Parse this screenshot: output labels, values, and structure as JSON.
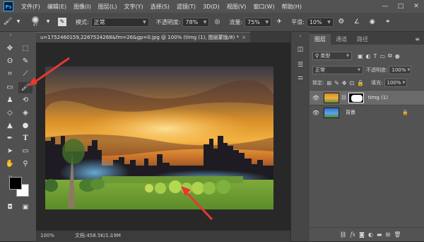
{
  "app": {
    "logo": "Ps"
  },
  "menu": [
    "文件(F)",
    "编辑(E)",
    "图像(I)",
    "图层(L)",
    "文字(Y)",
    "选择(S)",
    "滤镜(T)",
    "3D(D)",
    "视图(V)",
    "窗口(W)",
    "帮助(H)"
  ],
  "window_controls": {
    "minimize": "—",
    "maximize": "□",
    "close": "✕"
  },
  "options": {
    "brush_size": "47",
    "mode_label": "模式:",
    "mode_value": "正常",
    "opacity_label": "不透明度:",
    "opacity_value": "78%",
    "flow_label": "流量:",
    "flow_value": "75%",
    "smooth_label": "平滑:",
    "smooth_value": "10%"
  },
  "document": {
    "tab_title": "u=1752460159,2267524268&fm=26&gp=0.jpg @ 100% (timg (1), 图层蒙版/8) *",
    "close": "×"
  },
  "status": {
    "zoom": "100%",
    "doc_size": "文档:458.5K/1.19M"
  },
  "layers_panel": {
    "tabs": [
      "图层",
      "通道",
      "路径"
    ],
    "filter_kind": "类型",
    "blend_mode": "正常",
    "opacity_label": "不透明度:",
    "opacity_value": "100%",
    "lock_label": "锁定:",
    "fill_label": "填充:",
    "fill_value": "100%",
    "layers": [
      {
        "name": "timg (1)",
        "visible": true,
        "selected": true,
        "has_mask": true
      },
      {
        "name": "背景",
        "visible": true,
        "selected": false,
        "locked": true
      }
    ]
  },
  "colors": {
    "accent": "#31a8ff",
    "arrow": "#e8372f",
    "foreground": "#000000",
    "background": "#ffffff"
  }
}
